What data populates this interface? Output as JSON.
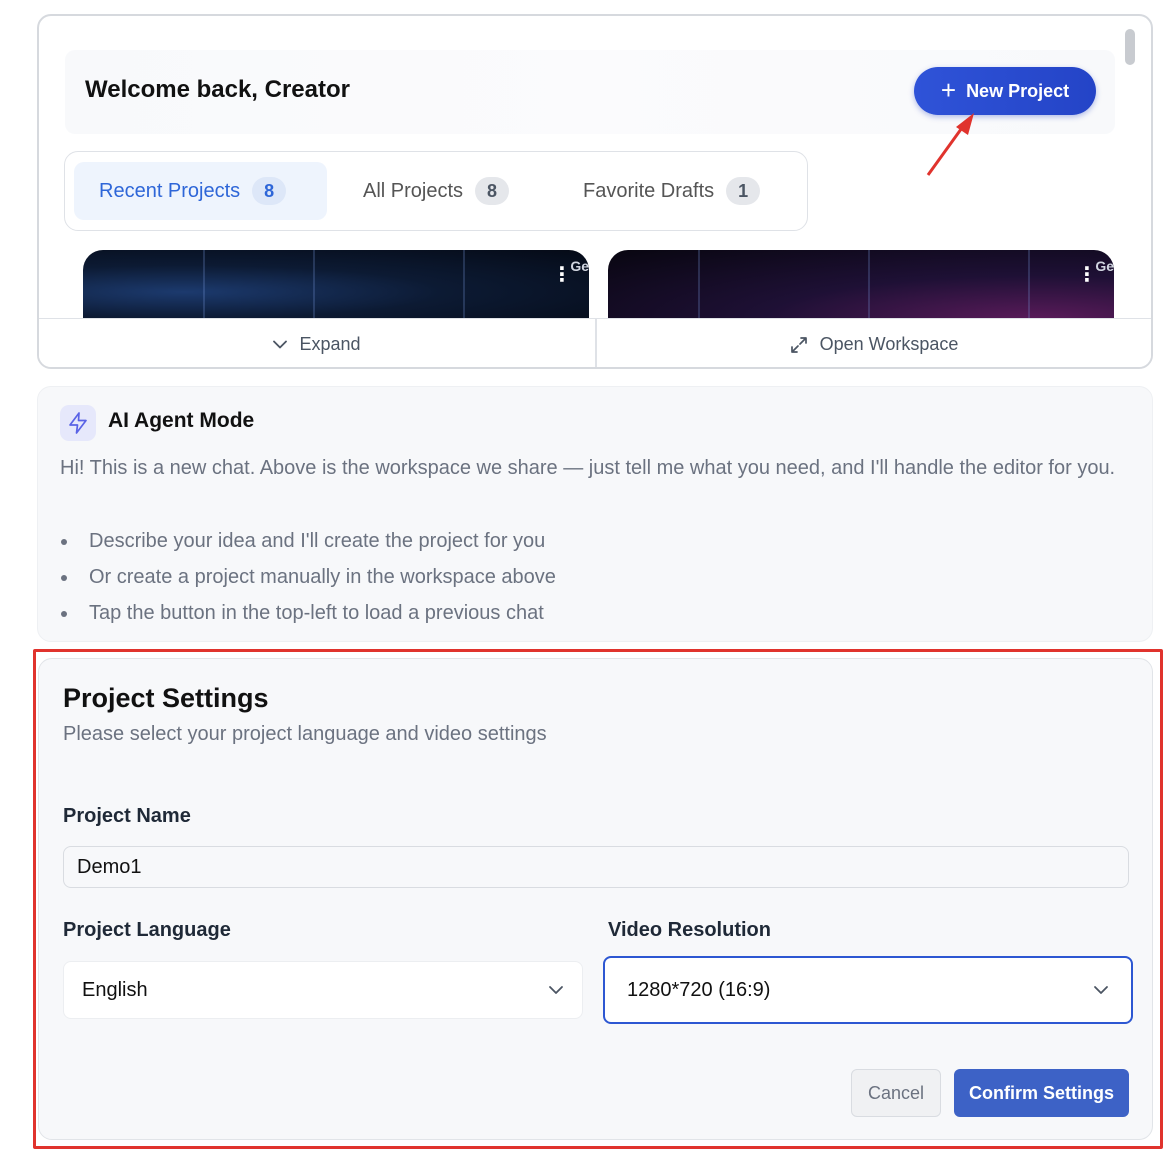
{
  "workspace": {
    "welcome": "Welcome back, Creator",
    "new_project_label": "New Project",
    "tabs": [
      {
        "label": "Recent Projects",
        "count": "8",
        "active": true
      },
      {
        "label": "All Projects",
        "count": "8",
        "active": false
      },
      {
        "label": "Favorite Drafts",
        "count": "1",
        "active": false
      }
    ],
    "cards": [
      {
        "tag": "Ge",
        "menu_icon": "more-vertical-icon"
      },
      {
        "tag": "Ge",
        "menu_icon": "more-vertical-icon"
      }
    ],
    "footer": {
      "expand_label": "Expand",
      "expand_icon": "chevron-down-icon",
      "open_label": "Open Workspace",
      "open_icon": "expand-arrows-icon"
    }
  },
  "agent": {
    "icon": "lightning-icon",
    "title": "AI Agent Mode",
    "intro": "Hi! This is a new chat. Above is the workspace we share — just tell me what you need, and I'll handle the editor for you.",
    "items": [
      "Describe your idea and I'll create the project for you",
      "Or create a project manually in the workspace above",
      "Tap the button in the top-left to load a previous chat"
    ]
  },
  "settings": {
    "title": "Project Settings",
    "subtitle": "Please select your project language and video settings",
    "name_label": "Project Name",
    "name_value": "Demo1",
    "language_label": "Project Language",
    "language_value": "English",
    "resolution_label": "Video Resolution",
    "resolution_value": "1280*720 (16:9)",
    "cancel_label": "Cancel",
    "confirm_label": "Confirm Settings"
  },
  "colors": {
    "accent": "#2444c7",
    "annotation": "#e0332d",
    "active_tab_text": "#2e66d8"
  }
}
